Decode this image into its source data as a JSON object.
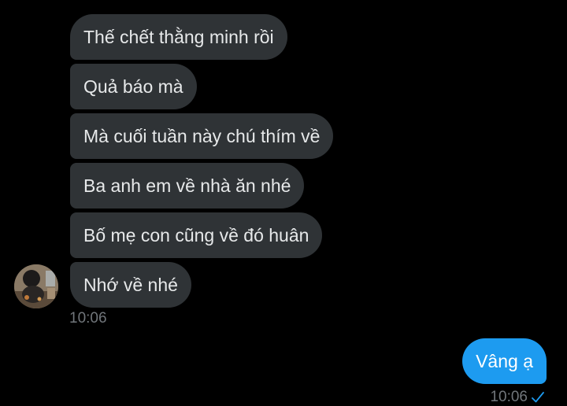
{
  "conversation": {
    "received": [
      {
        "text": "Thế chết thằng minh rồi"
      },
      {
        "text": "Quả báo mà"
      },
      {
        "text": "Mà cuối tuần này chú thím về"
      },
      {
        "text": "Ba anh em về nhà ăn nhé"
      },
      {
        "text": "Bố mẹ con cũng về đó huân"
      },
      {
        "text": "Nhớ về nhé"
      }
    ],
    "received_time": "10:06",
    "sent": [
      {
        "text": "Vâng ạ"
      }
    ],
    "sent_time": "10:06",
    "sent_status_icon": "check-icon"
  },
  "colors": {
    "background": "#000000",
    "received_bubble": "#2f3336",
    "sent_bubble": "#1d9bf0",
    "timestamp": "#71767b",
    "accent": "#1d9bf0"
  }
}
